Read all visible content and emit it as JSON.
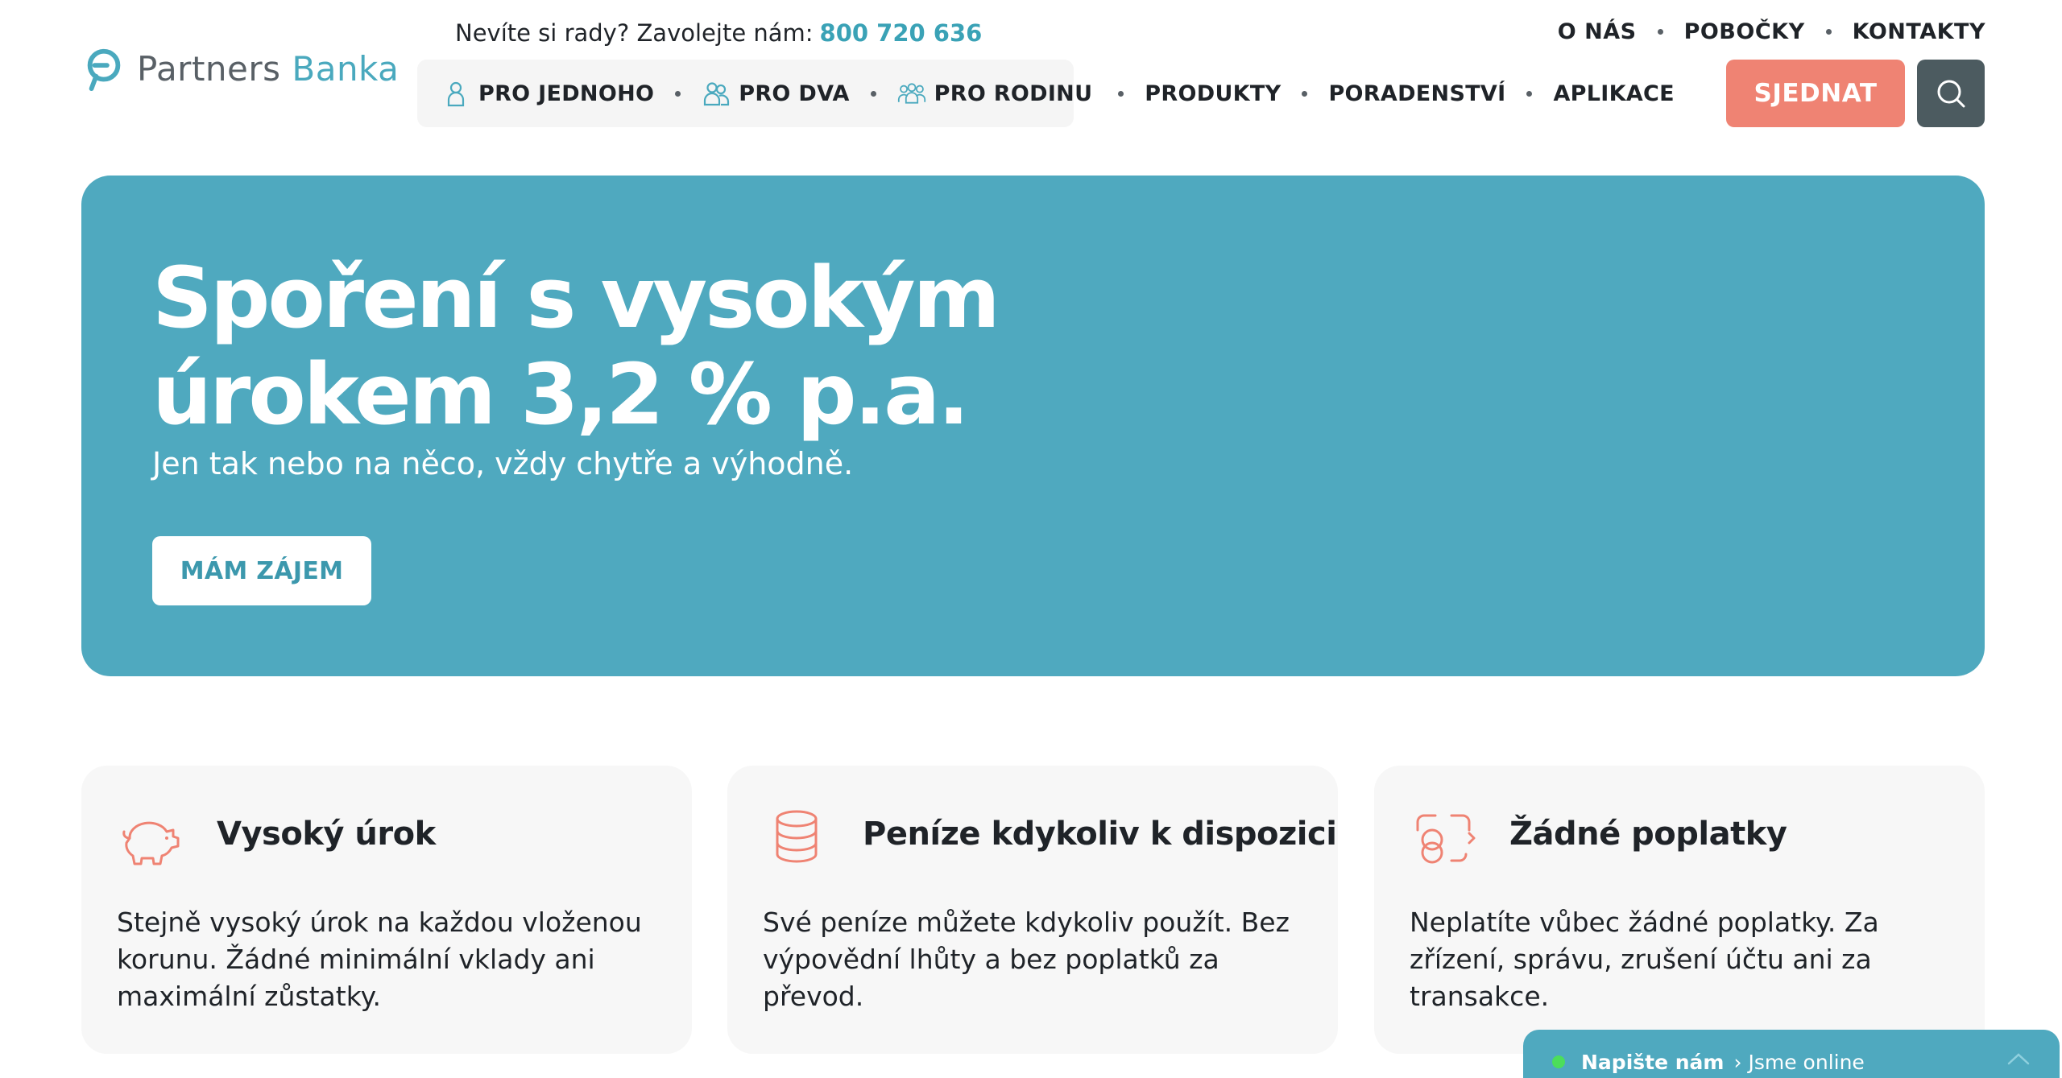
{
  "brand": {
    "name_part1": "Partners",
    "name_part2": "Banka",
    "logo_icon": "partners-logo-icon",
    "colors": {
      "accent": "#4fa9bf",
      "cta": "#ef8373",
      "dark": "#4c5b60"
    }
  },
  "header": {
    "helpline_text": "Nevíte si rady? Zavolejte nám:",
    "helpline_phone": "800 720 636",
    "top_links": [
      "O NÁS",
      "POBOČKY",
      "KONTAKTY"
    ],
    "nav": [
      {
        "label": "PRO JEDNOHO",
        "icon": "person-icon"
      },
      {
        "label": "PRO DVA",
        "icon": "two-persons-icon"
      },
      {
        "label": "PRO RODINU",
        "icon": "family-icon"
      },
      {
        "label": "PRODUKTY"
      },
      {
        "label": "PORADENSTVÍ"
      },
      {
        "label": "APLIKACE"
      }
    ],
    "cta_label": "SJEDNAT",
    "search_icon": "search-icon"
  },
  "hero": {
    "title_line1": "Spoření s vysokým",
    "title_line2": "úrokem 3,2 % p.a.",
    "subtitle": "Jen tak nebo na něco, vždy chytře a výhodně.",
    "button_label": "MÁM ZÁJEM"
  },
  "features": [
    {
      "icon": "piggy-bank-icon",
      "title": "Vysoký úrok",
      "text": "Stejně vysoký úrok na každou vloženou korunu. Žádné minimální vklady ani maximální zůstatky."
    },
    {
      "icon": "coin-stack-icon",
      "title": "Peníze kdykoliv k dispozici",
      "text": "Své peníze můžete kdykoliv použít. Bez výpovědní lhůty a bez poplatků za převod."
    },
    {
      "icon": "no-fees-icon",
      "title": "Žádné poplatky",
      "text": "Neplatíte vůbec žádné poplatky. Za zřízení, správu, zrušení účtu ani za transakce."
    }
  ],
  "chat": {
    "title": "Napište nám",
    "separator": "›",
    "status": "Jsme online",
    "status_color": "#4cde5a"
  }
}
